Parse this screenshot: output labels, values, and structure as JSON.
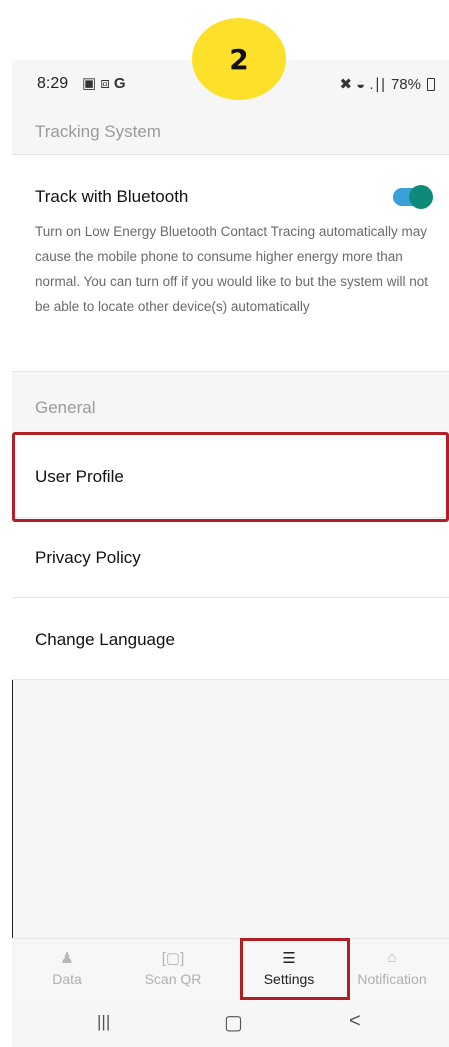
{
  "badge": {
    "number": "2"
  },
  "status": {
    "time": "8:29",
    "left_icons": "▣ ⧈",
    "g_icon": "G",
    "right_icons": "✖ ◒ .∣|",
    "battery": "78%"
  },
  "tracking": {
    "section_title": "Tracking System",
    "title": "Track with Bluetooth",
    "description": "Turn on Low Energy Bluetooth Contact Tracing automatically may cause the mobile phone to consume higher energy more than normal. You can turn off if you would like to but the system will not be able to locate other device(s) automatically",
    "toggle_on": true
  },
  "general": {
    "section_title": "General",
    "items": [
      {
        "label": "User Profile"
      },
      {
        "label": "Privacy Policy"
      },
      {
        "label": "Change Language"
      }
    ]
  },
  "tabs": [
    {
      "label": "Data",
      "icon": "person-icon",
      "glyph": "♟"
    },
    {
      "label": "Scan QR",
      "icon": "scan-qr-icon",
      "glyph": "[▢]"
    },
    {
      "label": "Settings",
      "icon": "settings-list-icon",
      "glyph": "☰"
    },
    {
      "label": "Notification",
      "icon": "bell-icon",
      "glyph": "⌂"
    }
  ],
  "nav": {
    "recent": "|||",
    "home": "▢",
    "back": "<"
  },
  "colors": {
    "highlight": "#b01f23",
    "badge": "#fde02a",
    "toggle_track": "#3aa0d8",
    "toggle_knob": "#0d8a7a"
  }
}
